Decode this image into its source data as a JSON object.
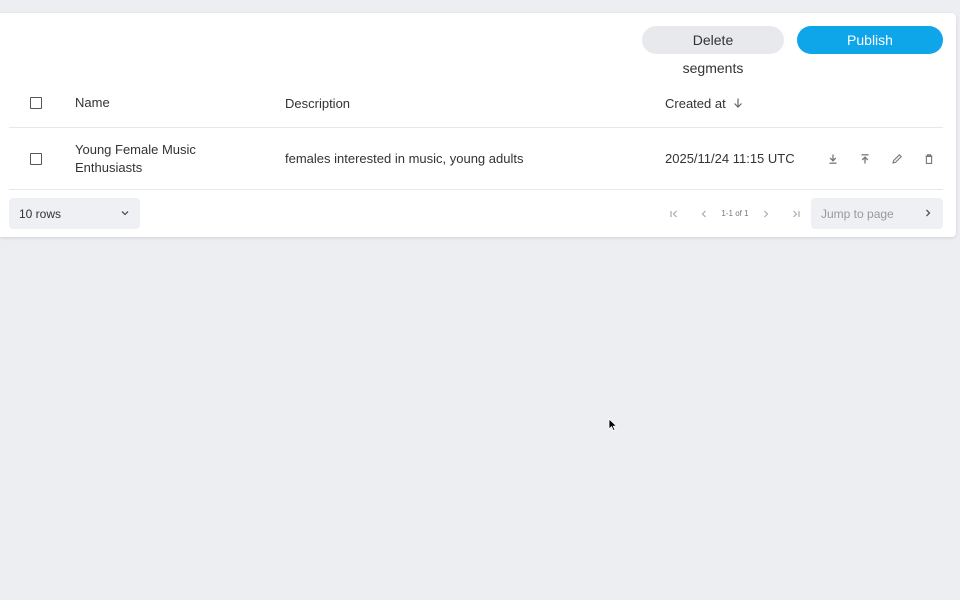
{
  "toolbar": {
    "delete_label": "Delete segments",
    "publish_label": "Publish segments"
  },
  "table": {
    "columns": {
      "name": "Name",
      "description": "Description",
      "created_at": "Created at"
    },
    "rows": [
      {
        "name": "Young Female Music Enthusiasts",
        "description": "females interested in music, young adults",
        "created_at": "2025/11/24 11:15 UTC",
        "actions": [
          "download-icon",
          "publish-icon",
          "edit-icon",
          "delete-icon"
        ]
      }
    ]
  },
  "footer": {
    "rows_per_page": "10 rows",
    "page_info": "1-1 of 1",
    "jump_placeholder": "Jump to page"
  },
  "colors": {
    "primary": "#0ea5e9",
    "secondary": "#e8e9ec",
    "background": "#eceef1"
  },
  "icons": {
    "sort": "arrow-down-icon",
    "select_chevron": "chevron-down-icon",
    "first_page": "first-page-icon",
    "prev_page": "chevron-left-icon",
    "next_page": "chevron-right-icon",
    "last_page": "last-page-icon",
    "jump_go": "chevron-right-icon"
  }
}
